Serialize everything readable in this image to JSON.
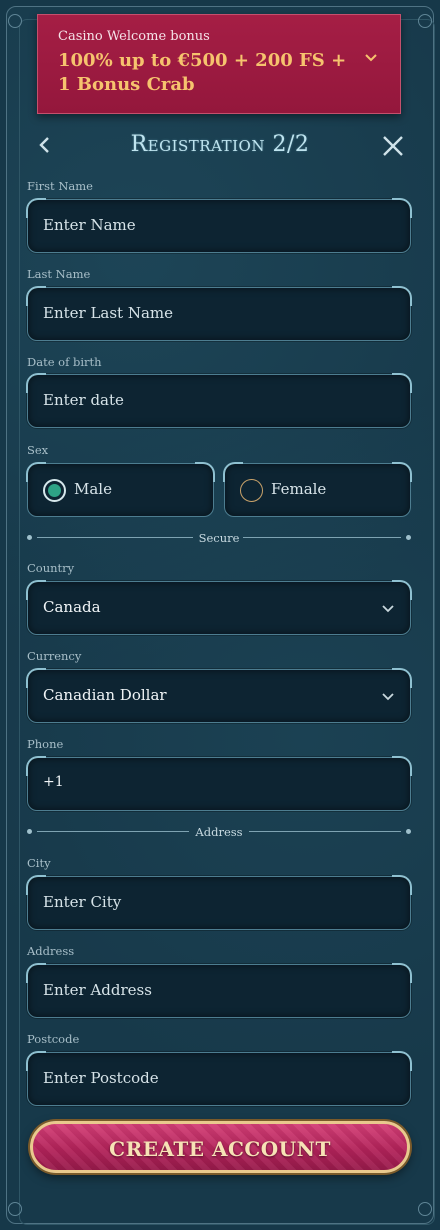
{
  "banner": {
    "subtitle": "Casino Welcome bonus",
    "title": "100% up to €500 + 200 FS + 1 Bonus Crab"
  },
  "header": {
    "title": "Registration 2/2"
  },
  "fields": {
    "first_name": {
      "label": "First Name",
      "placeholder": "Enter Name"
    },
    "last_name": {
      "label": "Last Name",
      "placeholder": "Enter Last Name"
    },
    "dob": {
      "label": "Date of birth",
      "placeholder": "Enter date"
    },
    "sex": {
      "label": "Sex",
      "options": [
        "Male",
        "Female"
      ],
      "selected": "Male"
    },
    "country": {
      "label": "Country",
      "value": "Canada"
    },
    "currency": {
      "label": "Currency",
      "value": "Canadian Dollar"
    },
    "phone": {
      "label": "Phone",
      "value": "+1"
    },
    "city": {
      "label": "City",
      "placeholder": "Enter City"
    },
    "address": {
      "label": "Address",
      "placeholder": "Enter Address"
    },
    "postcode": {
      "label": "Postcode",
      "placeholder": "Enter Postcode"
    }
  },
  "dividers": {
    "secure": "Secure",
    "address": "Address"
  },
  "actions": {
    "create": "CREATE ACCOUNT"
  },
  "colors": {
    "background": "#17394a",
    "banner": "#a51e45",
    "banner_title": "#f6c36e",
    "accent_green": "#2ea386",
    "button": "#c02e66"
  }
}
